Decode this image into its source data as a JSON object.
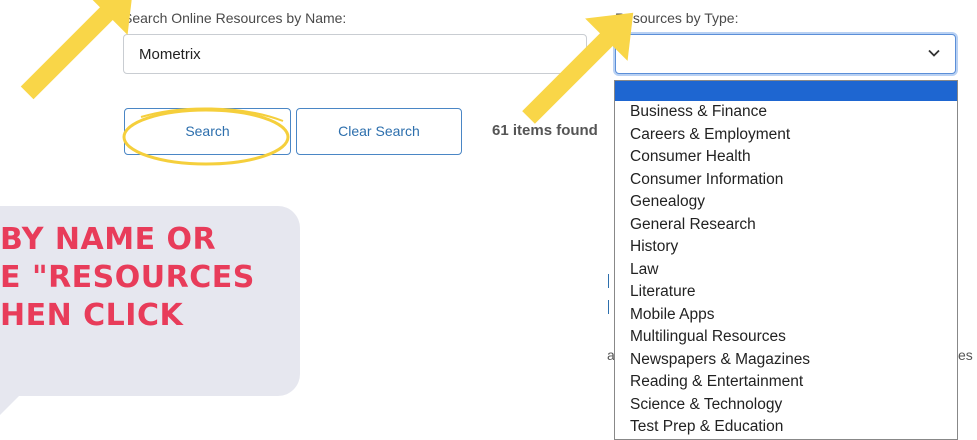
{
  "search": {
    "name_label": "Search Online Resources by Name:",
    "name_value": "Mometrix",
    "type_label": "Resources by Type:",
    "type_value": ""
  },
  "buttons": {
    "search_label": "Search",
    "clear_label": "Clear Search"
  },
  "results": {
    "found_text": "61 items found"
  },
  "type_options": [
    "Business & Finance",
    "Careers & Employment",
    "Consumer Health",
    "Consumer Information",
    "Genealogy",
    "General Research",
    "History",
    "Law",
    "Literature",
    "Mobile Apps",
    "Multilingual Resources",
    "Newspapers & Magazines",
    "Reading & Entertainment",
    "Science & Technology",
    "Test Prep & Education"
  ],
  "callout": {
    "line1": "BY NAME OR",
    "line2": "E \"RESOURCES",
    "line3": "HEN CLICK"
  },
  "background_fragments": {
    "frag1": "a",
    "frag2": "es"
  },
  "colors": {
    "arrow": "#f9d648",
    "callout_text": "#e83c5a",
    "callout_bg": "#e6e7ef",
    "highlight_circle": "#f5cf3c",
    "dropdown_selected": "#1e66d1",
    "button_border": "#4a86c5"
  },
  "icons": {
    "select_chevron": "chevron-down-icon",
    "arrows": "arrow-icon"
  }
}
